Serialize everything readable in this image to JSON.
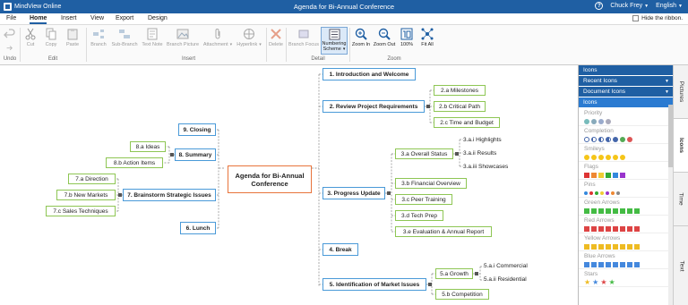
{
  "titlebar": {
    "app_name": "MindView Online",
    "document_title": "Agenda for Bi-Annual Conference",
    "user": "Chuck Frey",
    "language": "English"
  },
  "menu": {
    "tabs": [
      "File",
      "Home",
      "Insert",
      "View",
      "Export",
      "Design"
    ],
    "active": "Home",
    "hide_ribbon": "Hide the ribbon."
  },
  "ribbon": {
    "buttons": {
      "cut": "Cut",
      "copy": "Copy",
      "paste": "Paste",
      "branch": "Branch",
      "sub_branch": "Sub-Branch",
      "text_note": "Text Note",
      "branch_picture": "Branch Picture",
      "attachment": "Attachment",
      "hyperlink": "Hyperlink",
      "delete": "Delete",
      "branch_focus": "Branch Focus",
      "numbering_line1": "Numbering",
      "numbering_line2": "Scheme",
      "zoom_in": "Zoom In",
      "zoom_out": "Zoom Out",
      "zoom_100": "100%",
      "fit_all": "Fit All"
    },
    "groups": {
      "undo": "Undo",
      "edit": "Edit",
      "insert": "Insert",
      "detail": "Detail",
      "zoom": "Zoom"
    }
  },
  "map": {
    "root": "Agenda for Bi-Annual Conference",
    "nodes": {
      "n1": "1. Introduction and Welcome",
      "n2": "2. Review Project Requirements",
      "n2a": "2.a Milestones",
      "n2b": "2.b Critical Path",
      "n2c": "2.c Time and Budget",
      "n3": "3. Progress Update",
      "n3a": "3.a Overall Status",
      "n3ai": "3.a.i Highlights",
      "n3aii": "3.a.ii Results",
      "n3aiii": "3.a.iii Showcases",
      "n3b": "3.b Financial Overview",
      "n3c": "3.c Peer Training",
      "n3d": "3.d Tech Prep",
      "n3e": "3.e Evaluation & Annual Report",
      "n4": "4. Break",
      "n5": "5. Identification of Market Issues",
      "n5a": "5.a Growth",
      "n5ai": "5.a.i Commercial",
      "n5aii": "5.a.ii Residential",
      "n5b": "5.b Competition",
      "n6": "6. Lunch",
      "n7": "7. Brainstorm Strategic Issues",
      "n7a": "7.a Direction",
      "n7b": "7.b New Markets",
      "n7c": "7.c Sales Techniques",
      "n8": "8. Summary",
      "n8a": "8.a Ideas",
      "n8b": "8.b Action Items",
      "n9": "9. Closing"
    }
  },
  "panel": {
    "heads": [
      "Icons",
      "Recent Icons",
      "Document Icons",
      "Icons"
    ],
    "sections": [
      "Priority",
      "Completion",
      "Smileys",
      "Flags",
      "Pins",
      "Green Arrows",
      "Red Arrows",
      "Yellow Arrows",
      "Blue Arrows",
      "Stars"
    ]
  },
  "side_tabs": [
    "Pictures",
    "Icons",
    "Time",
    "Text"
  ],
  "colors": {
    "brand": "#1f5fa3",
    "main_node_border": "#4a9ad8",
    "sub_node_border": "#8ec654",
    "root_border": "#e8743b"
  }
}
